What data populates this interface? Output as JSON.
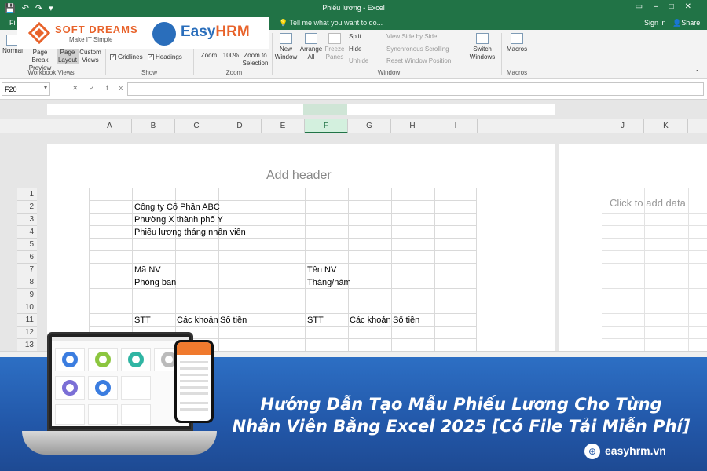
{
  "window": {
    "title": "Phiếu lương - Excel",
    "tell_me": "Tell me what you want to do...",
    "sign_in": "Sign in",
    "share": "Share",
    "file_tab": "Fi"
  },
  "ribbon": {
    "workbook_views": {
      "normal": "Normal",
      "page_break": "Page Break Preview",
      "page_layout": "Page Layout",
      "custom_views": "Custom Views",
      "group_label": "Workbook Views"
    },
    "show": {
      "gridlines": "Gridlines",
      "headings": "Headings",
      "group_label": "Show"
    },
    "zoom": {
      "zoom": "Zoom",
      "hundred": "100%",
      "zoom_selection": "Zoom to Selection",
      "group_label": "Zoom"
    },
    "window": {
      "new_window": "New Window",
      "arrange_all": "Arrange All",
      "freeze_panes": "Freeze Panes",
      "split": "Split",
      "hide": "Hide",
      "unhide": "Unhide",
      "view_side": "View Side by Side",
      "sync_scroll": "Synchronous Scrolling",
      "reset_pos": "Reset Window Position",
      "switch_windows": "Switch Windows",
      "group_label": "Window"
    },
    "macros": {
      "macros": "Macros",
      "group_label": "Macros"
    }
  },
  "logos": {
    "softdreams": "SOFT DREAMS",
    "softdreams_tag": "Make IT Simple",
    "easyhrm_a": "Easy",
    "easyhrm_b": "HRM"
  },
  "formula_bar": {
    "name_box": "F20",
    "fx": "fx",
    "value": ""
  },
  "columns": [
    "A",
    "B",
    "C",
    "D",
    "E",
    "F",
    "G",
    "H",
    "I",
    "J",
    "K"
  ],
  "selected_column": "F",
  "rows": [
    "1",
    "2",
    "3",
    "4",
    "5",
    "6",
    "7",
    "8",
    "9",
    "10",
    "11",
    "12",
    "13"
  ],
  "page": {
    "add_header": "Add header",
    "click_to_add": "Click to add data"
  },
  "cells": {
    "b2": "Công ty Cổ Phần ABC",
    "b3": "Phường X thành phố Y",
    "b4": "Phiếu lương tháng nhân viên",
    "b7": "Mã NV",
    "f7": "Tên NV",
    "b8": "Phòng ban",
    "f8": "Tháng/năm",
    "b11": "STT",
    "c11": "Các khoản",
    "d11": "Số tiền",
    "f11": "STT",
    "g11": "Các khoản",
    "h11": "Số tiền"
  },
  "banner": {
    "title_line1": "Hướng Dẫn Tạo Mẫu Phiếu Lương Cho Từng",
    "title_line2": "Nhân Viên Bằng Excel 2025 [Có File Tải Miễn Phí]",
    "site": "easyhrm.vn"
  }
}
